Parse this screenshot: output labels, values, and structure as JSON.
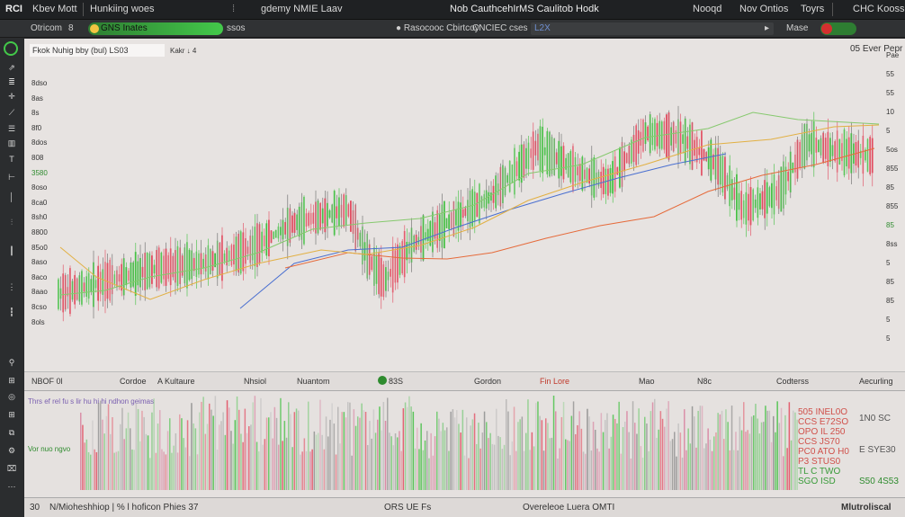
{
  "topbar": {
    "logo": "RCI",
    "menu_1": "Kbev Mott",
    "menu_2": "Hunkiing woes",
    "menu_3": "gdemy NMIE Laav",
    "title": "Nob CauthcehIrMS Caulitob Hodk",
    "menu_4": "Nooqd",
    "menu_5": "Nov Ontios",
    "menu_6": "Toyrs",
    "menu_7": "CHC Kooss"
  },
  "toolbar2": {
    "item_1": "Otricom",
    "item_2": "8",
    "pill_label": "GNS Inates",
    "item_3": "ssos",
    "item_4": "● Rasocooc Cbirtcoy",
    "item_5": "CNCIEC",
    "item_6": "cses",
    "item_7": "L2X",
    "item_8": "Mase"
  },
  "chart": {
    "legend": "Fkok Nuhig bby (bul) LS03",
    "legend_extra": "Kakr  ↓  4",
    "top_right": "05 Ever  Pepr",
    "price_labels_left": [
      "8dso",
      "8as",
      "8s",
      "8f0",
      "8dos",
      "808",
      "3580",
      "8oso",
      "8ca0",
      "8sh0",
      "8800",
      "85o0",
      "8aso",
      "8aco",
      "8aao",
      "8cso",
      "8ols"
    ],
    "price_labels_right": [
      "Pae",
      "55",
      "55",
      "10",
      "5",
      "5os",
      "855",
      "85",
      "855",
      "85",
      "8ss",
      "5",
      "85",
      "85",
      "5",
      "5"
    ],
    "accent_green": "#3fbf3f",
    "accent_red": "#e2455a",
    "ma_colors": [
      "#4a6fd0",
      "#e66a3a",
      "#e2b043",
      "#86c96e"
    ]
  },
  "strip": {
    "item_1": "NBOF 0l",
    "item_2": "Cordoe",
    "item_3": "A Kultaure",
    "item_4": "Nhsiol",
    "item_5": "Nuantom",
    "item_6": "83S",
    "item_7": "Gordon",
    "item_8": "Fin Lore",
    "item_9": "Mao",
    "item_10": "N8c",
    "item_11": "Codterss",
    "item_12": "Aecurling"
  },
  "volume": {
    "header": "Thrs ef rel fu s lir hu hi hi ndhon geimas",
    "label_left": "Vor nuo ngvo",
    "stats": [
      "505 INEL0O",
      "CCS E72SO",
      "OPO IL 250",
      "CCS JS70",
      "PC0 ATO H0",
      "P3 STUS0",
      "TL C TWO",
      "SGO ISD"
    ],
    "stats_right": [
      "1N0 SC",
      "E SYE30",
      "S50 4S53"
    ]
  },
  "bottom": {
    "item_1": "30",
    "item_2": "N/Mioheshhiop | % l hoficon Phies 37",
    "item_3": "ORS UE Fs",
    "item_4": "Overeleoe Luera OMTI",
    "item_5": "Mlutroliscal"
  }
}
